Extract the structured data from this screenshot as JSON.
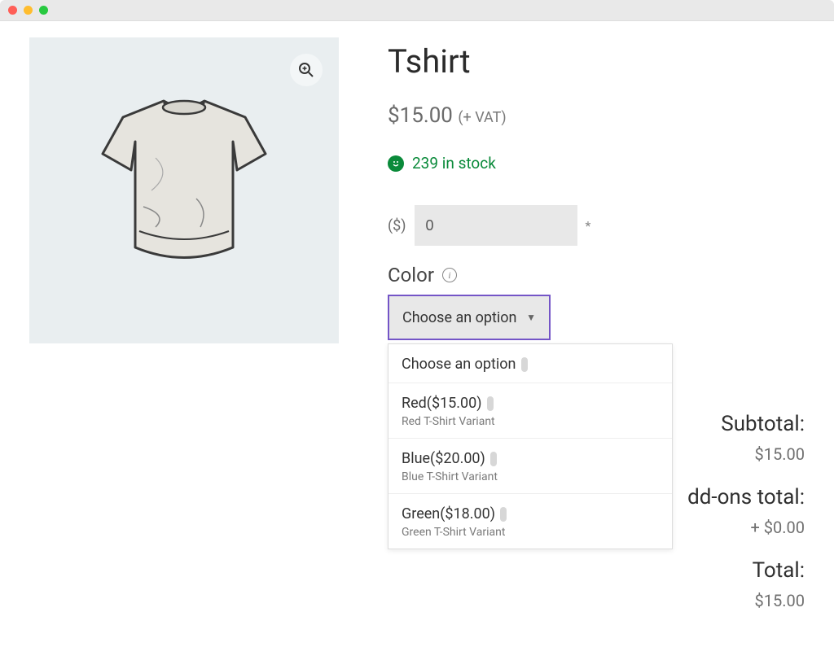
{
  "product": {
    "title": "Tshirt",
    "price_display": "$15.00",
    "vat_suffix": "(+ VAT)",
    "stock_text": "239 in stock"
  },
  "addon": {
    "prefix_label": "($)",
    "value": "0",
    "required_mark": "*"
  },
  "color": {
    "label": "Color",
    "selected": "Choose an option",
    "options": [
      {
        "label": "Choose an option",
        "desc": ""
      },
      {
        "label": "Red($15.00)",
        "desc": "Red T-Shirt Variant"
      },
      {
        "label": "Blue($20.00)",
        "desc": "Blue T-Shirt Variant"
      },
      {
        "label": "Green($18.00)",
        "desc": "Green T-Shirt Variant"
      }
    ]
  },
  "totals": {
    "subtotal_label": "Subtotal:",
    "subtotal_value": "$15.00",
    "addons_label": "dd-ons total:",
    "addons_value": "+ $0.00",
    "total_label": "Total:",
    "total_value": "$15.00"
  }
}
